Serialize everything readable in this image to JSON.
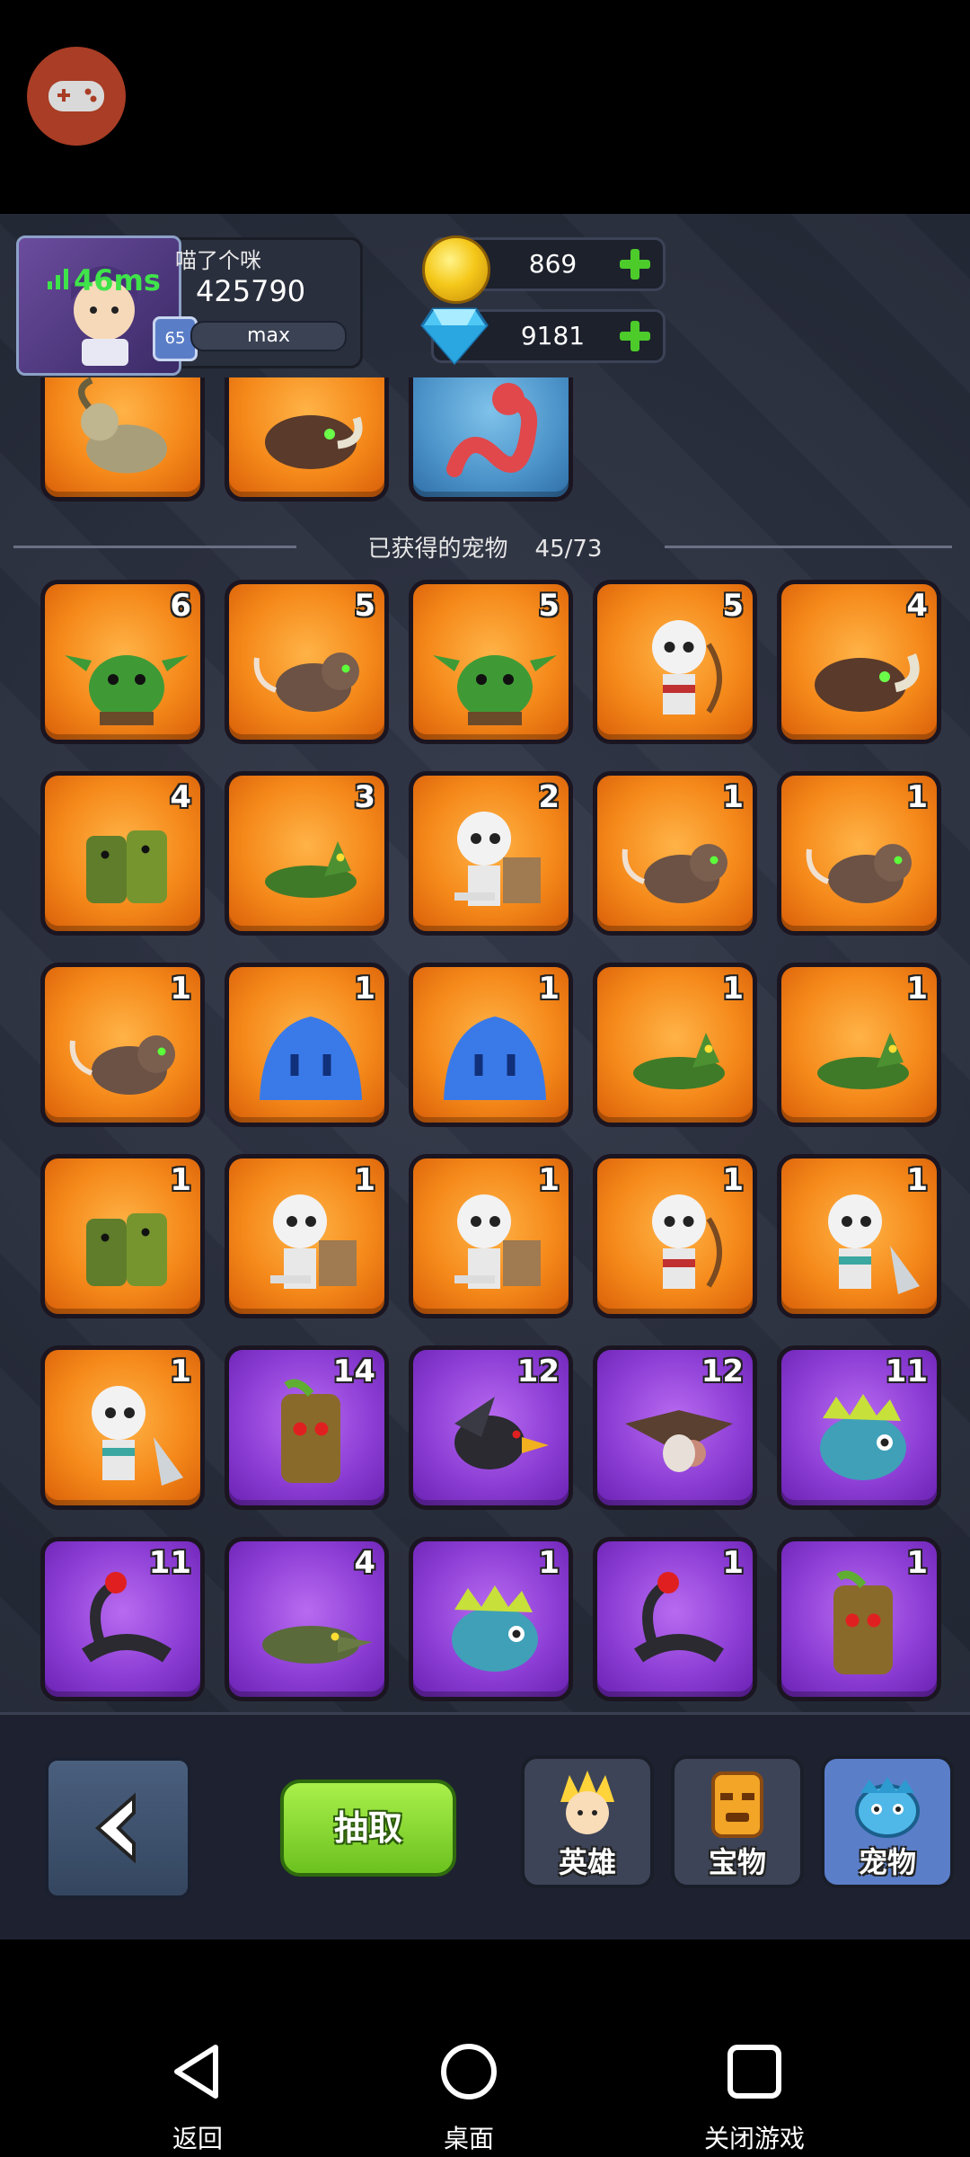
{
  "floating_button": {
    "icon": "gamepad-icon"
  },
  "player": {
    "name": "喵了个咪",
    "score": "425790",
    "ping": "46ms",
    "level": "65",
    "xp_label": "max"
  },
  "currency": {
    "gold": "869",
    "gems": "9181"
  },
  "partial_row": [
    {
      "pet": "goat",
      "rarity": "orange"
    },
    {
      "pet": "boar",
      "rarity": "orange"
    },
    {
      "pet": "worm",
      "rarity": "blue"
    }
  ],
  "section": {
    "title": "已获得的宠物",
    "count": "45/73"
  },
  "pets": [
    {
      "pet": "goblin",
      "count": "6",
      "rarity": "orange"
    },
    {
      "pet": "rat",
      "count": "5",
      "rarity": "orange"
    },
    {
      "pet": "goblin",
      "count": "5",
      "rarity": "orange"
    },
    {
      "pet": "skeleton-archer",
      "count": "5",
      "rarity": "orange"
    },
    {
      "pet": "boar",
      "count": "4",
      "rarity": "orange"
    },
    {
      "pet": "zombie",
      "count": "4",
      "rarity": "orange"
    },
    {
      "pet": "lizard",
      "count": "3",
      "rarity": "orange"
    },
    {
      "pet": "skeleton-shield",
      "count": "2",
      "rarity": "orange"
    },
    {
      "pet": "rat",
      "count": "1",
      "rarity": "orange"
    },
    {
      "pet": "rat",
      "count": "1",
      "rarity": "orange"
    },
    {
      "pet": "rat",
      "count": "1",
      "rarity": "orange"
    },
    {
      "pet": "slime",
      "count": "1",
      "rarity": "orange"
    },
    {
      "pet": "slime",
      "count": "1",
      "rarity": "orange"
    },
    {
      "pet": "lizard",
      "count": "1",
      "rarity": "orange"
    },
    {
      "pet": "lizard",
      "count": "1",
      "rarity": "orange"
    },
    {
      "pet": "zombie",
      "count": "1",
      "rarity": "orange"
    },
    {
      "pet": "skeleton-shield",
      "count": "1",
      "rarity": "orange"
    },
    {
      "pet": "skeleton-shield",
      "count": "1",
      "rarity": "orange"
    },
    {
      "pet": "skeleton-archer",
      "count": "1",
      "rarity": "orange"
    },
    {
      "pet": "skeleton-axe",
      "count": "1",
      "rarity": "orange"
    },
    {
      "pet": "skeleton-axe",
      "count": "1",
      "rarity": "orange"
    },
    {
      "pet": "treant",
      "count": "14",
      "rarity": "purple"
    },
    {
      "pet": "crow",
      "count": "12",
      "rarity": "purple"
    },
    {
      "pet": "vulture",
      "count": "12",
      "rarity": "purple"
    },
    {
      "pet": "fish-lizard",
      "count": "11",
      "rarity": "purple"
    },
    {
      "pet": "scorpion",
      "count": "11",
      "rarity": "purple"
    },
    {
      "pet": "croc",
      "count": "4",
      "rarity": "purple"
    },
    {
      "pet": "fish-lizard",
      "count": "1",
      "rarity": "purple"
    },
    {
      "pet": "scorpion",
      "count": "1",
      "rarity": "purple"
    },
    {
      "pet": "treant",
      "count": "1",
      "rarity": "purple"
    }
  ],
  "bottom": {
    "draw_label": "抽取",
    "tabs": [
      {
        "label": "英雄",
        "icon": "hero-icon"
      },
      {
        "label": "宝物",
        "icon": "treasure-icon"
      },
      {
        "label": "宠物",
        "icon": "pet-icon"
      }
    ]
  },
  "navbar": {
    "back": "返回",
    "home": "桌面",
    "close": "关闭游戏"
  },
  "colors": {
    "orange_tile": "#f5891a",
    "purple_tile": "#8e3fd6",
    "blue_tile": "#4b93c9",
    "ping_green": "#3fe34a",
    "draw_green": "#6cc11f"
  }
}
